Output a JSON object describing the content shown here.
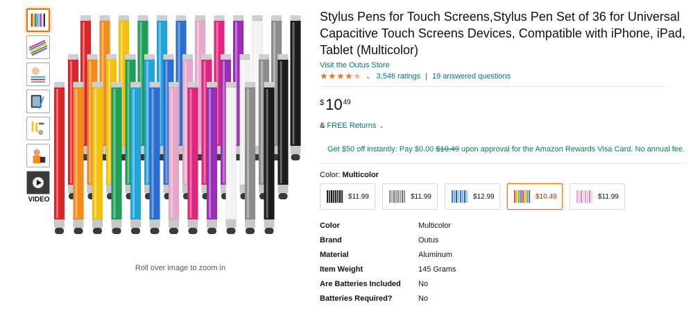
{
  "thumbnails": [
    {
      "name": "thumb-1",
      "active": true
    },
    {
      "name": "thumb-2",
      "active": false
    },
    {
      "name": "thumb-3",
      "active": false
    },
    {
      "name": "thumb-4",
      "active": false
    },
    {
      "name": "thumb-5",
      "active": false
    },
    {
      "name": "thumb-6",
      "active": false
    },
    {
      "name": "thumb-video",
      "active": false
    }
  ],
  "video_label": "VIDEO",
  "zoom_hint": "Roll over image to zoom in",
  "product": {
    "title": "Stylus Pens for Touch Screens,Stylus Pen Set of 36 for Universal Capacitive Touch Screens Devices, Compatible with iPhone, iPad, Tablet (Multicolor)",
    "store_link": "Visit the Outus Store",
    "rating_stars": 4.5,
    "ratings_count": "3,546 ratings",
    "answered": "19 answered questions",
    "price": {
      "currency": "$",
      "whole": "10",
      "fraction": "49"
    },
    "returns_prefix": "& ",
    "returns_link": "FREE Returns",
    "promo_before": "Get $50 off instantly: Pay $0.00 ",
    "promo_strike": "$10.49",
    "promo_after": " upon approval for the Amazon Rewards Visa Card. No annual fee.",
    "color_label": "Color:",
    "color_value": "Multicolor"
  },
  "swatches": [
    {
      "price": "$11.99",
      "selected": false,
      "palette": [
        "#222",
        "#444",
        "#111",
        "#333"
      ]
    },
    {
      "price": "$11.99",
      "selected": false,
      "palette": [
        "#888",
        "#aaa",
        "#777",
        "#999"
      ]
    },
    {
      "price": "$12.99",
      "selected": false,
      "palette": [
        "#3a7bd5",
        "#6fb1fc",
        "#2c5fa3",
        "#9cc9ff"
      ]
    },
    {
      "price": "$10.49",
      "selected": true,
      "palette": [
        "#e74c3c",
        "#f1c40f",
        "#2ecc71",
        "#9b59b6"
      ]
    },
    {
      "price": "$11.99",
      "selected": false,
      "palette": [
        "#e9a3c9",
        "#f5c6e0",
        "#d48ab5",
        "#fbd3e9"
      ]
    }
  ],
  "specs": [
    {
      "key": "Color",
      "value": "Multicolor"
    },
    {
      "key": "Brand",
      "value": "Outus"
    },
    {
      "key": "Material",
      "value": "Aluminum"
    },
    {
      "key": "Item Weight",
      "value": "145 Grams"
    },
    {
      "key": "Are Batteries Included",
      "value": "No"
    },
    {
      "key": "Batteries Required?",
      "value": "No"
    }
  ],
  "colors": {
    "link": "#007185",
    "star": "#de7921",
    "promo": "#067d62",
    "selected_border": "#e77600",
    "price_red": "#b12704"
  },
  "pen_colors": [
    "#d8262c",
    "#f28c1c",
    "#f4c20d",
    "#1e9e59",
    "#22a3d9",
    "#2a6fd0",
    "#e8a7c8",
    "#e0257f",
    "#9a2fb5",
    "#f2f2f2",
    "#8c8c8c",
    "#1a1a1a"
  ]
}
